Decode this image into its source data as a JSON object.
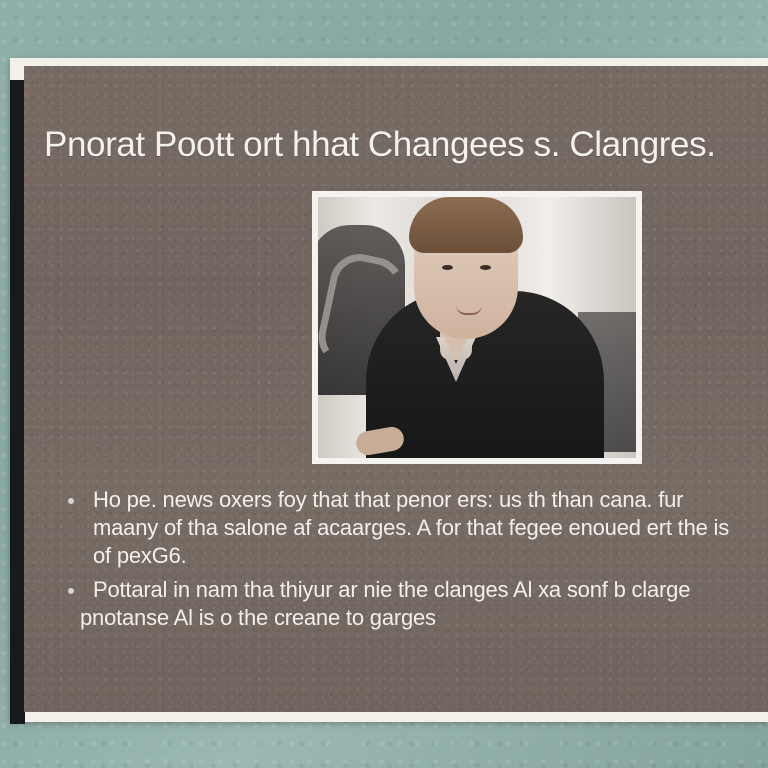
{
  "slide": {
    "title": "Pnorat Poott ort hhat Changees s. Clangres.",
    "bullets": [
      {
        "lines": [
          "Ho pe. news oxers foy that that penor ers: us th than cana. fur",
          "maany of tha salone af acaarges. A for that fegee enoued ert the is",
          "of pexG6."
        ]
      },
      {
        "lines": [
          "Pottaral in nam tha thiyur ar nie the clanges Al xa sonf b clarge",
          "pnotanse Al is o the creane to garges"
        ]
      }
    ]
  },
  "image": {
    "subject": "portrait photo of young man in black sweater"
  },
  "colors": {
    "background": "#8fb0a8",
    "board": "#756a62",
    "frame": "#f3f0ea",
    "text": "#f2efea"
  }
}
